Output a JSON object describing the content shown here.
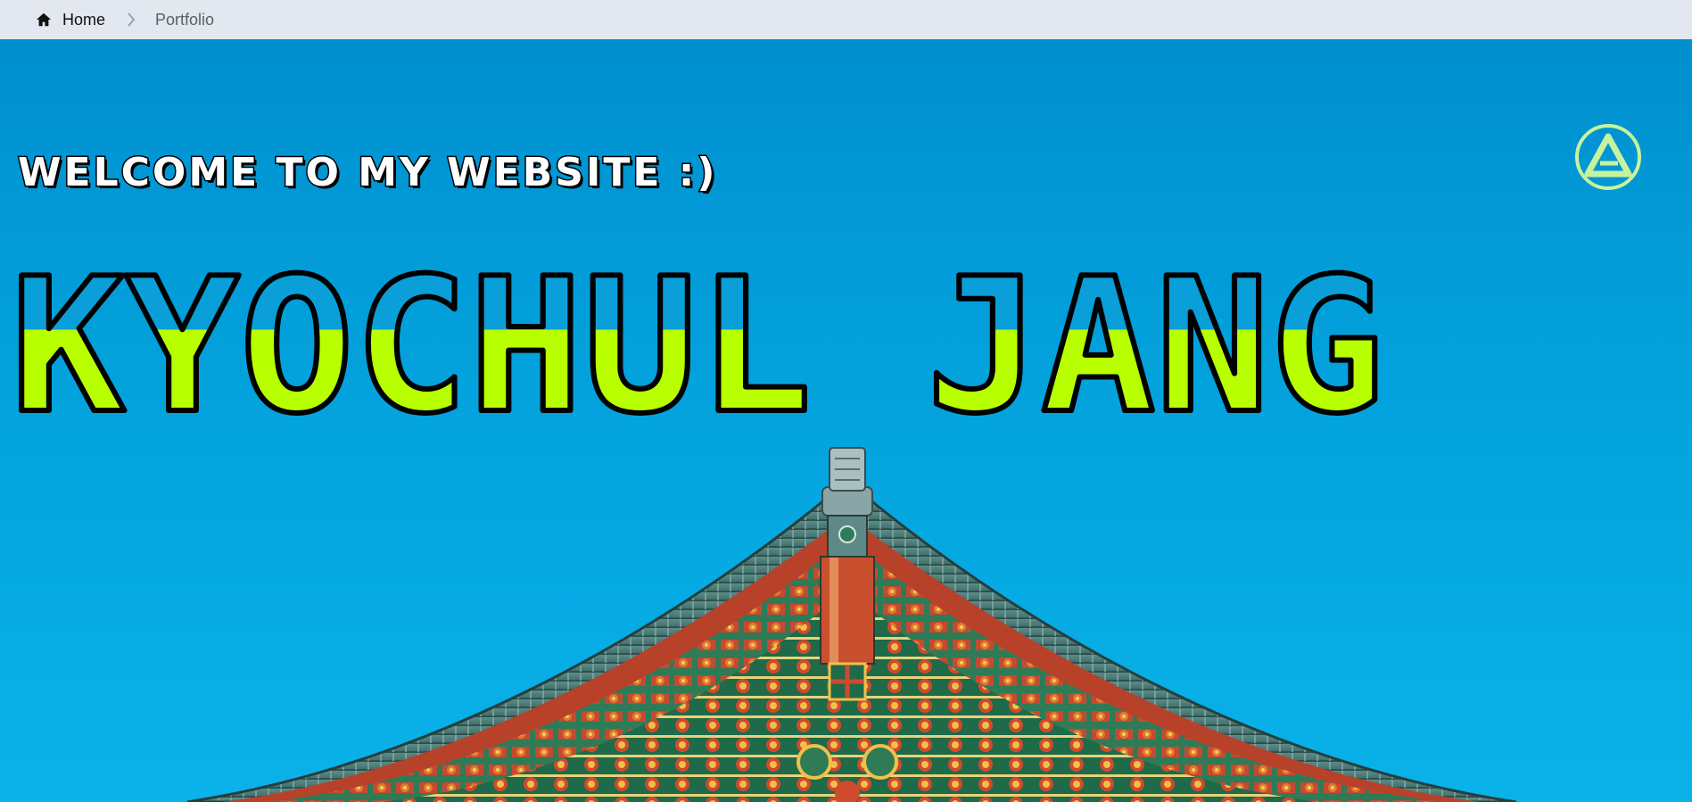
{
  "breadcrumb": {
    "home_label": "Home",
    "current_label": "Portfolio",
    "home_icon": "home-icon",
    "separator_icon": "chevron-right-icon"
  },
  "hero": {
    "welcome": "WELCOME TO MY WEBSITE :)",
    "name": "KYOCHUL JANG",
    "logo_icon": "triangle-logo-icon",
    "colors": {
      "sky": "#009fd9",
      "name_fill": "#b8ff00",
      "outline": "#000000",
      "logo_green": "#c8f39c"
    }
  }
}
